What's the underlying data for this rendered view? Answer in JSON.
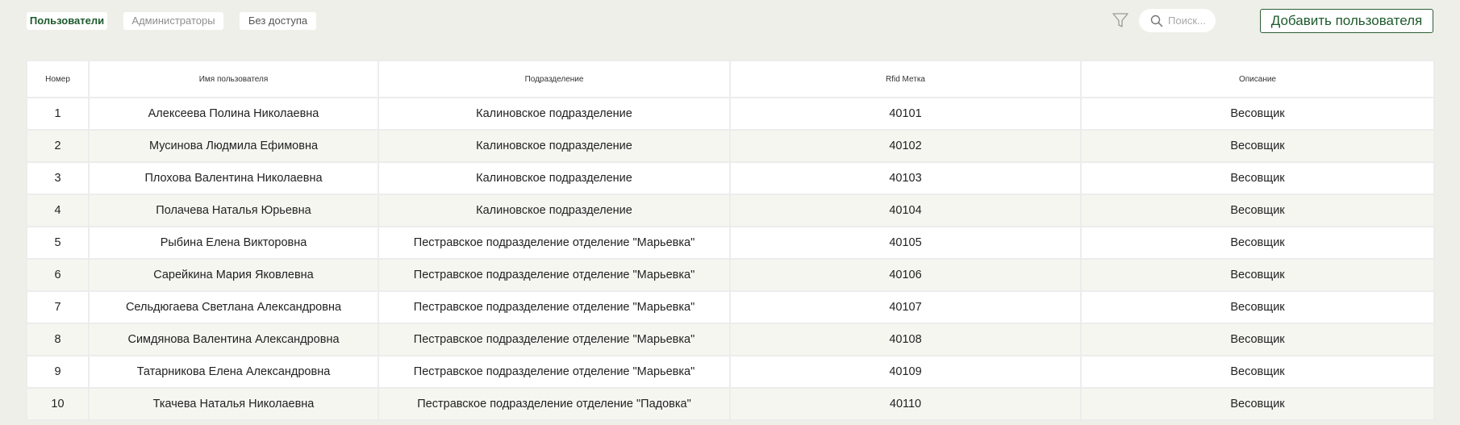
{
  "tabs": {
    "users": "Пользователи",
    "admins": "Администраторы",
    "no_access": "Без доступа"
  },
  "search": {
    "placeholder": "Поиск..."
  },
  "add_user_label": "Добавить пользователя",
  "icons": {
    "filter": "filter-icon",
    "search": "search-icon"
  },
  "colors": {
    "accent": "#1d5a2c",
    "background": "#efefe9",
    "row_alt": "#f6f6f1"
  },
  "table": {
    "headers": {
      "number": "Номер",
      "name": "Имя пользователя",
      "division": "Подразделение",
      "rfid": "Rfid Метка",
      "description": "Описание"
    },
    "rows": [
      {
        "number": "1",
        "name": "Алексеева Полина Николаевна",
        "division": "Калиновское подразделение",
        "rfid": "40101",
        "description": "Весовщик"
      },
      {
        "number": "2",
        "name": "Мусинова Людмила Ефимовна",
        "division": "Калиновское подразделение",
        "rfid": "40102",
        "description": "Весовщик"
      },
      {
        "number": "3",
        "name": "Плохова Валентина Николаевна",
        "division": "Калиновское подразделение",
        "rfid": "40103",
        "description": "Весовщик"
      },
      {
        "number": "4",
        "name": "Полачева Наталья Юрьевна",
        "division": "Калиновское подразделение",
        "rfid": "40104",
        "description": "Весовщик"
      },
      {
        "number": "5",
        "name": "Рыбина Елена Викторовна",
        "division": "Пестравское подразделение отделение \"Марьевка\"",
        "rfid": "40105",
        "description": "Весовщик"
      },
      {
        "number": "6",
        "name": "Сарейкина Мария Яковлевна",
        "division": "Пестравское подразделение отделение \"Марьевка\"",
        "rfid": "40106",
        "description": "Весовщик"
      },
      {
        "number": "7",
        "name": "Сельдюгаева Светлана Александровна",
        "division": "Пестравское подразделение отделение \"Марьевка\"",
        "rfid": "40107",
        "description": "Весовщик"
      },
      {
        "number": "8",
        "name": "Симдянова Валентина Александровна",
        "division": "Пестравское подразделение отделение \"Марьевка\"",
        "rfid": "40108",
        "description": "Весовщик"
      },
      {
        "number": "9",
        "name": "Татарникова Елена Александровна",
        "division": "Пестравское подразделение отделение \"Марьевка\"",
        "rfid": "40109",
        "description": "Весовщик"
      },
      {
        "number": "10",
        "name": "Ткачева Наталья Николаевна",
        "division": "Пестравское подразделение отделение \"Падовка\"",
        "rfid": "40110",
        "description": "Весовщик"
      }
    ]
  }
}
